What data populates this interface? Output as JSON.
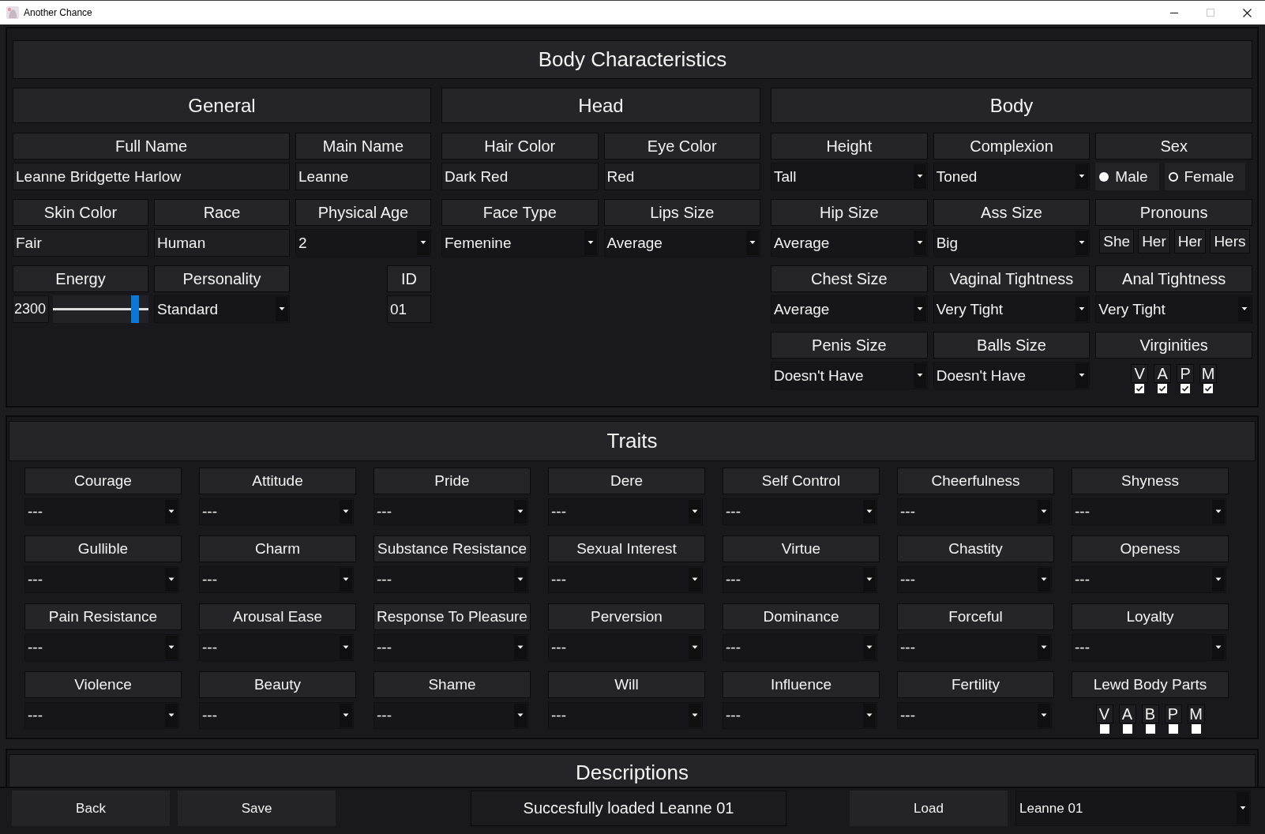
{
  "window": {
    "title": "Another Chance",
    "controls": [
      {
        "kind": "minimize",
        "disabled": false
      },
      {
        "kind": "maximize",
        "disabled": true
      },
      {
        "kind": "close",
        "disabled": false
      }
    ]
  },
  "body_characteristics": {
    "title": "Body Characteristics",
    "sections": [
      {
        "title": "General",
        "rows": [
          [
            {
              "label": "Full Name",
              "kind": "text",
              "value": "Leanne Bridgette Harlow"
            },
            {
              "label": "Main Name",
              "kind": "text",
              "value": "Leanne"
            }
          ],
          [
            {
              "label": "Skin Color",
              "kind": "text",
              "value": "Fair"
            },
            {
              "label": "Race",
              "kind": "text",
              "value": "Human"
            },
            {
              "label": "Physical Age",
              "kind": "dropdown",
              "value": "2"
            }
          ],
          [
            {
              "label": "Energy",
              "kind": "slider",
              "value": "2300",
              "level": 0.89
            },
            {
              "label": "Personality",
              "kind": "dropdown",
              "value": "Standard"
            },
            {
              "label": "ID",
              "kind": "short_text",
              "value": "01"
            }
          ]
        ]
      },
      {
        "title": "Head",
        "rows": [
          [
            {
              "label": "Hair Color",
              "kind": "text",
              "value": "Dark Red"
            },
            {
              "label": "Eye Color",
              "kind": "text",
              "value": "Red"
            }
          ],
          [
            {
              "label": "Face Type",
              "kind": "dropdown",
              "value": "Femenine"
            },
            {
              "label": "Lips Size",
              "kind": "dropdown",
              "value": "Average"
            }
          ]
        ]
      },
      {
        "title": "Body",
        "rows": [
          [
            {
              "label": "Height",
              "kind": "dropdown",
              "value": "Tall"
            },
            {
              "label": "Complexion",
              "kind": "dropdown",
              "value": "Toned"
            },
            {
              "label": "Sex",
              "kind": "radio",
              "options": [
                {
                  "label": "Male",
                  "selected": true
                },
                {
                  "label": "Female",
                  "selected": false
                }
              ]
            }
          ],
          [
            {
              "label": "Hip Size",
              "kind": "dropdown",
              "value": "Average"
            },
            {
              "label": "Ass Size",
              "kind": "dropdown",
              "value": "Big"
            },
            {
              "label": "Pronouns",
              "kind": "pronouns",
              "values": [
                "She",
                "Her",
                "Her",
                "Hers"
              ]
            }
          ],
          [
            {
              "label": "Chest Size",
              "kind": "dropdown",
              "value": "Average"
            },
            {
              "label": "Vaginal Tightness",
              "kind": "dropdown",
              "value": "Very Tight"
            },
            {
              "label": "Anal Tightness",
              "kind": "dropdown",
              "value": "Very Tight"
            }
          ],
          [
            {
              "label": "Penis Size",
              "kind": "dropdown",
              "value": "Doesn't Have"
            },
            {
              "label": "Balls Size",
              "kind": "dropdown",
              "value": "Doesn't Have"
            },
            {
              "label": "Virginities",
              "kind": "checks",
              "options": [
                {
                  "label": "V",
                  "checked": true
                },
                {
                  "label": "A",
                  "checked": true
                },
                {
                  "label": "P",
                  "checked": true
                },
                {
                  "label": "M",
                  "checked": true
                }
              ]
            }
          ]
        ]
      }
    ]
  },
  "traits": {
    "title": "Traits",
    "items": [
      {
        "label": "Courage",
        "kind": "dropdown",
        "value": "---"
      },
      {
        "label": "Attitude",
        "kind": "dropdown",
        "value": "---"
      },
      {
        "label": "Pride",
        "kind": "dropdown",
        "value": "---"
      },
      {
        "label": "Dere",
        "kind": "dropdown",
        "value": "---"
      },
      {
        "label": "Self Control",
        "kind": "dropdown",
        "value": "---"
      },
      {
        "label": "Cheerfulness",
        "kind": "dropdown",
        "value": "---"
      },
      {
        "label": "Shyness",
        "kind": "dropdown",
        "value": "---"
      },
      {
        "label": "Gullible",
        "kind": "dropdown",
        "value": "---"
      },
      {
        "label": "Charm",
        "kind": "dropdown",
        "value": "---"
      },
      {
        "label": "Substance Resistance",
        "kind": "dropdown",
        "value": "---"
      },
      {
        "label": "Sexual Interest",
        "kind": "dropdown",
        "value": "---"
      },
      {
        "label": "Virtue",
        "kind": "dropdown",
        "value": "---"
      },
      {
        "label": "Chastity",
        "kind": "dropdown",
        "value": "---"
      },
      {
        "label": "Openess",
        "kind": "dropdown",
        "value": "---"
      },
      {
        "label": "Pain Resistance",
        "kind": "dropdown",
        "value": "---"
      },
      {
        "label": "Arousal Ease",
        "kind": "dropdown",
        "value": "---"
      },
      {
        "label": "Response To Pleasure",
        "kind": "dropdown",
        "value": "---"
      },
      {
        "label": "Perversion",
        "kind": "dropdown",
        "value": "---"
      },
      {
        "label": "Dominance",
        "kind": "dropdown",
        "value": "---"
      },
      {
        "label": "Forceful",
        "kind": "dropdown",
        "value": "---"
      },
      {
        "label": "Loyalty",
        "kind": "dropdown",
        "value": "---"
      },
      {
        "label": "Violence",
        "kind": "dropdown",
        "value": "---"
      },
      {
        "label": "Beauty",
        "kind": "dropdown",
        "value": "---"
      },
      {
        "label": "Shame",
        "kind": "dropdown",
        "value": "---"
      },
      {
        "label": "Will",
        "kind": "dropdown",
        "value": "---"
      },
      {
        "label": "Influence",
        "kind": "dropdown",
        "value": "---"
      },
      {
        "label": "Fertility",
        "kind": "dropdown",
        "value": "---"
      },
      {
        "label": "Lewd Body Parts",
        "kind": "checks",
        "options": [
          {
            "label": "V",
            "checked": false
          },
          {
            "label": "A",
            "checked": false
          },
          {
            "label": "B",
            "checked": false
          },
          {
            "label": "P",
            "checked": false
          },
          {
            "label": "M",
            "checked": false
          }
        ]
      }
    ]
  },
  "descriptions": {
    "title": "Descriptions"
  },
  "bottom_bar": {
    "back_button": "Back",
    "save_button": "Save",
    "status": "Succesfully loaded Leanne 01",
    "load_button": "Load",
    "save_slot": {
      "value": "Leanne 01"
    }
  }
}
